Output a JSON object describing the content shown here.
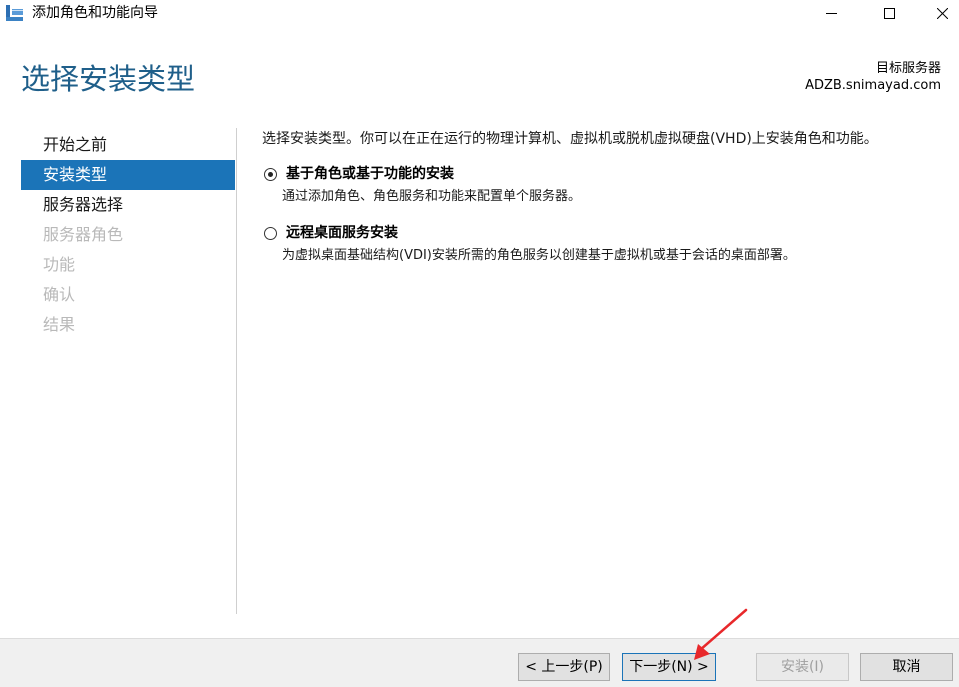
{
  "window": {
    "title": "添加角色和功能向导"
  },
  "header": {
    "page_title": "选择安装类型",
    "destination_label": "目标服务器",
    "destination_server": "ADZB.snimayad.com"
  },
  "nav": {
    "items": [
      {
        "label": "开始之前",
        "state": "normal"
      },
      {
        "label": "安装类型",
        "state": "active"
      },
      {
        "label": "服务器选择",
        "state": "normal"
      },
      {
        "label": "服务器角色",
        "state": "disabled"
      },
      {
        "label": "功能",
        "state": "disabled"
      },
      {
        "label": "确认",
        "state": "disabled"
      },
      {
        "label": "结果",
        "state": "disabled"
      }
    ]
  },
  "content": {
    "intro": "选择安装类型。你可以在正在运行的物理计算机、虚拟机或脱机虚拟硬盘(VHD)上安装角色和功能。",
    "options": [
      {
        "label": "基于角色或基于功能的安装",
        "description": "通过添加角色、角色服务和功能来配置单个服务器。",
        "selected": true
      },
      {
        "label": "远程桌面服务安装",
        "description": "为虚拟桌面基础结构(VDI)安装所需的角色服务以创建基于虚拟机或基于会话的桌面部署。",
        "selected": false
      }
    ]
  },
  "footer": {
    "prev_label": "< 上一步(P)",
    "next_label": "下一步(N) >",
    "install_label": "安装(I)",
    "cancel_label": "取消"
  },
  "colors": {
    "accent": "#1b74b8",
    "title_color": "#1f5f8a",
    "annotation_arrow": "#e8282b"
  },
  "icons": {
    "app": "server-manager-icon",
    "minimize": "minimize-icon",
    "maximize": "maximize-icon",
    "close": "close-icon"
  }
}
